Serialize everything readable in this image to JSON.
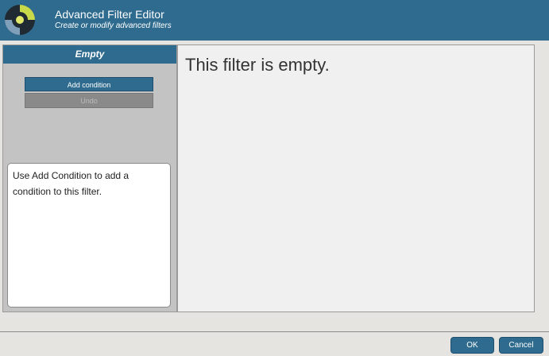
{
  "header": {
    "title": "Advanced Filter Editor",
    "subtitle": "Create or modify advanced filters",
    "logo_icon": "target-logo-icon"
  },
  "left_panel": {
    "status_label": "Empty",
    "add_condition_label": "Add condition",
    "undo_label": "Undo",
    "hint_text": "Use Add Condition to add a condition to this filter."
  },
  "main": {
    "empty_message": "This filter is empty."
  },
  "footer": {
    "ok_label": "OK",
    "cancel_label": "Cancel"
  },
  "colors": {
    "accent": "#2f6b8e",
    "panel_bg": "#c3c3c3",
    "content_bg": "#f0f0f0",
    "logo_yellow": "#c8d94a"
  }
}
